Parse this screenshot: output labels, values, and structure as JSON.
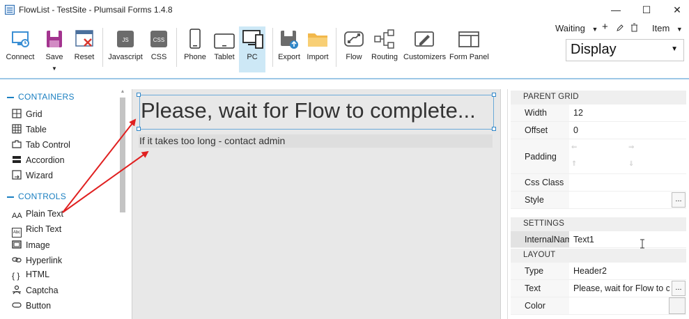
{
  "window": {
    "title": "FlowList - TestSite - Plumsail Forms 1.4.8",
    "minimize": "—",
    "maximize": "☐",
    "close": "✕"
  },
  "ribbon": {
    "buttons": [
      {
        "label": "Connect",
        "icon": "connect-icon"
      },
      {
        "label": "Save",
        "icon": "save-icon"
      },
      {
        "label": "Reset",
        "icon": "reset-icon"
      },
      {
        "label": "Javascript",
        "icon": "javascript-icon",
        "glyph": "JS"
      },
      {
        "label": "CSS",
        "icon": "css-icon",
        "glyph": "CSS"
      },
      {
        "label": "Phone",
        "icon": "phone-icon"
      },
      {
        "label": "Tablet",
        "icon": "tablet-icon"
      },
      {
        "label": "PC",
        "icon": "pc-icon"
      },
      {
        "label": "Export",
        "icon": "export-icon"
      },
      {
        "label": "Import",
        "icon": "import-icon"
      },
      {
        "label": "Flow",
        "icon": "flow-icon"
      },
      {
        "label": "Routing",
        "icon": "routing-icon"
      },
      {
        "label": "Customizers",
        "icon": "customizers-icon"
      },
      {
        "label": "Form Panel",
        "icon": "form-panel-icon"
      }
    ],
    "save_caret": "▼",
    "state_select": {
      "value": "Waiting",
      "caret": "▼"
    },
    "add_symbol": "+",
    "item_select": {
      "value": "Item",
      "caret": "▼"
    },
    "display_select": {
      "value": "Display",
      "caret": "▼"
    },
    "active_device": "PC"
  },
  "left_panel": {
    "containers_header": "CONTAINERS",
    "containers": [
      {
        "label": "Grid",
        "icon": "grid-icon"
      },
      {
        "label": "Table",
        "icon": "table-icon"
      },
      {
        "label": "Tab Control",
        "icon": "tab-control-icon"
      },
      {
        "label": "Accordion",
        "icon": "accordion-icon"
      },
      {
        "label": "Wizard",
        "icon": "wizard-icon"
      }
    ],
    "controls_header": "CONTROLS",
    "controls": [
      {
        "label": "Plain Text",
        "icon": "plain-text-icon",
        "glyph": "AA"
      },
      {
        "label": "Rich Text",
        "icon": "rich-text-icon",
        "glyph": "Abc"
      },
      {
        "label": "Image",
        "icon": "image-icon"
      },
      {
        "label": "Hyperlink",
        "icon": "hyperlink-icon"
      },
      {
        "label": "HTML",
        "icon": "html-icon",
        "glyph": "{ }"
      },
      {
        "label": "Captcha",
        "icon": "captcha-icon"
      },
      {
        "label": "Button",
        "icon": "button-icon"
      }
    ]
  },
  "canvas": {
    "header_text": "Please, wait for Flow to complete...",
    "sub_text": "If it takes too long - contact admin"
  },
  "properties": {
    "parent_grid_header": "PARENT GRID",
    "width": {
      "label": "Width",
      "value": "12"
    },
    "offset": {
      "label": "Offset",
      "value": "0"
    },
    "padding": {
      "label": "Padding"
    },
    "css_class": {
      "label": "Css Class",
      "value": ""
    },
    "style": {
      "label": "Style",
      "value": "",
      "button": "..."
    },
    "settings_header": "SETTINGS",
    "internal_name": {
      "label": "InternalName",
      "value": "Text1"
    },
    "layout_header": "LAYOUT",
    "type": {
      "label": "Type",
      "value": "Header2"
    },
    "text": {
      "label": "Text",
      "value": "Please, wait for Flow to complete...",
      "button": "..."
    },
    "color": {
      "label": "Color",
      "value": ""
    }
  },
  "colors": {
    "accent": "#1a7fc1",
    "selection_border": "#6aa9d8",
    "arrow": "#e02020",
    "active_tab": "#cde8f6"
  }
}
